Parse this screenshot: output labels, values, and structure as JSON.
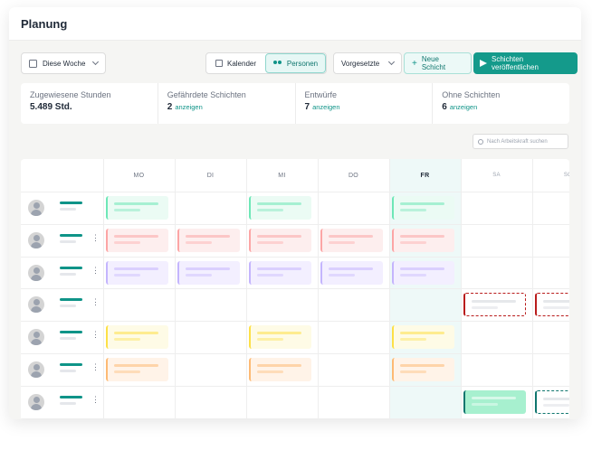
{
  "page": {
    "title": "Planung"
  },
  "toolbar": {
    "week_label": "Diese Woche",
    "view_calendar": "Kalender",
    "view_people": "Personen",
    "supervisor_label": "Vorgesetzte",
    "new_shift_label": "Neue Schicht",
    "publish_label": "Schichten veröffentlichen"
  },
  "stats": [
    {
      "label": "Zugewiesene Stunden",
      "value": "5.489 Std.",
      "link": ""
    },
    {
      "label": "Gefährdete Schichten",
      "value": "2",
      "link": "anzeigen"
    },
    {
      "label": "Entwürfe",
      "value": "7",
      "link": "anzeigen"
    },
    {
      "label": "Ohne Schichten",
      "value": "6",
      "link": "anzeigen"
    }
  ],
  "search": {
    "placeholder": "Nach Arbeitskraft suchen"
  },
  "days": [
    "MO",
    "DI",
    "MI",
    "DO",
    "FR",
    "SA",
    "SO"
  ],
  "today_index": 4,
  "colors": {
    "accent": "#149a8b",
    "green": "#6ee7b7",
    "red": "#fca5a5",
    "purple": "#c4b5fd",
    "yellow": "#fde047",
    "orange": "#fdba74",
    "dashed_red": "#b91c1c",
    "solid_green": "#34d399"
  },
  "employees": [
    {
      "has_menu": false,
      "shifts": [
        {
          "day": 0,
          "color": "green"
        },
        {
          "day": 2,
          "color": "green"
        },
        {
          "day": 4,
          "color": "green"
        }
      ]
    },
    {
      "has_menu": true,
      "shifts": [
        {
          "day": 0,
          "color": "red"
        },
        {
          "day": 1,
          "color": "red"
        },
        {
          "day": 2,
          "color": "red"
        },
        {
          "day": 3,
          "color": "red"
        },
        {
          "day": 4,
          "color": "red"
        }
      ]
    },
    {
      "has_menu": true,
      "shifts": [
        {
          "day": 0,
          "color": "purple"
        },
        {
          "day": 1,
          "color": "purple"
        },
        {
          "day": 2,
          "color": "purple"
        },
        {
          "day": 3,
          "color": "purple"
        },
        {
          "day": 4,
          "color": "purple"
        }
      ]
    },
    {
      "has_menu": true,
      "shifts": [
        {
          "day": 5,
          "color": "dashed_red"
        },
        {
          "day": 6,
          "color": "dashed_red"
        }
      ]
    },
    {
      "has_menu": true,
      "shifts": [
        {
          "day": 0,
          "color": "yellow"
        },
        {
          "day": 2,
          "color": "yellow"
        },
        {
          "day": 4,
          "color": "yellow"
        }
      ]
    },
    {
      "has_menu": true,
      "shifts": [
        {
          "day": 0,
          "color": "orange"
        },
        {
          "day": 2,
          "color": "orange"
        },
        {
          "day": 4,
          "color": "orange"
        }
      ]
    },
    {
      "has_menu": true,
      "shifts": [
        {
          "day": 5,
          "color": "solid_green"
        },
        {
          "day": 6,
          "color": "dashed_green"
        }
      ]
    }
  ]
}
